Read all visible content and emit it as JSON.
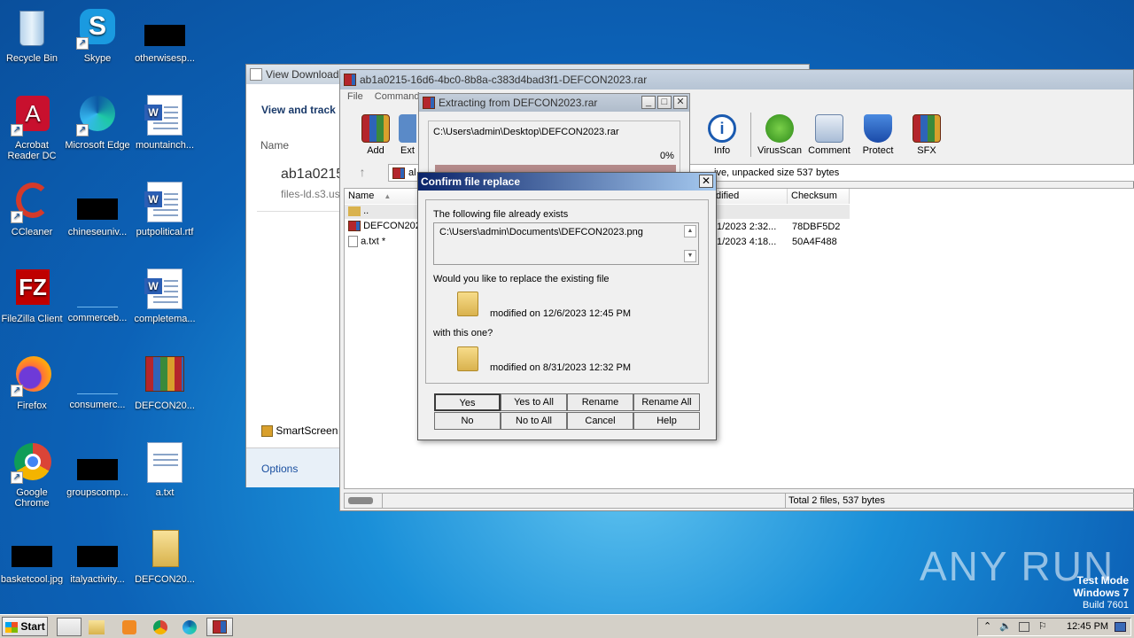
{
  "desktop": {
    "icons": [
      {
        "label": "Recycle Bin"
      },
      {
        "label": "Skype"
      },
      {
        "label": "otherwisesp..."
      },
      {
        "label": "Acrobat Reader DC"
      },
      {
        "label": "Microsoft Edge"
      },
      {
        "label": "mountainch..."
      },
      {
        "label": "CCleaner"
      },
      {
        "label": "chineseuniv..."
      },
      {
        "label": "putpolitical.rtf"
      },
      {
        "label": "FileZilla Client"
      },
      {
        "label": "commerceb..."
      },
      {
        "label": "completema..."
      },
      {
        "label": "Firefox"
      },
      {
        "label": "consumerc..."
      },
      {
        "label": "DEFCON20..."
      },
      {
        "label": "Google Chrome"
      },
      {
        "label": "groupscomp..."
      },
      {
        "label": "a.txt"
      },
      {
        "label": "basketcool.jpg"
      },
      {
        "label": "italyactivity..."
      },
      {
        "label": "DEFCON20..."
      }
    ]
  },
  "downloads_window": {
    "title": "View Downloads",
    "heading": "View and track",
    "col_name": "Name",
    "item_name": "ab1a0215",
    "item_source": "files-ld.s3.us",
    "smartscreen": "SmartScreen",
    "options": "Options"
  },
  "winrar": {
    "title": "ab1a0215-16d6-4bc0-8b8a-c383d4bad3f1-DEFCON2023.rar",
    "menu": {
      "file": "File",
      "commands": "Commands"
    },
    "toolbar": {
      "add": "Add",
      "extract": "Ext",
      "info": "Info",
      "virusscan": "VirusScan",
      "comment": "Comment",
      "protect": "Protect",
      "sfx": "SFX"
    },
    "path_info": "ive, unpacked size 537 bytes",
    "path_prefix": "al",
    "columns": {
      "name": "Name",
      "modified": "dified",
      "checksum": "Checksum"
    },
    "rows": [
      {
        "name": "..",
        "modified": "",
        "checksum": ""
      },
      {
        "name": "DEFCON202",
        "modified": "1/2023 2:32...",
        "checksum": "78DBF5D2"
      },
      {
        "name": "a.txt *",
        "modified": "1/2023 4:18...",
        "checksum": "50A4F488"
      }
    ],
    "status_total": "Total 2 files, 537 bytes"
  },
  "extract_window": {
    "title": "Extracting from DEFCON2023.rar",
    "path": "C:\\Users\\admin\\Desktop\\DEFCON2023.rar",
    "percent": "0%"
  },
  "confirm": {
    "title": "Confirm file replace",
    "exists_text": "The following file already exists",
    "file_path": "C:\\Users\\admin\\Documents\\DEFCON2023.png",
    "question": "Would you like to replace the existing file",
    "existing_modified": "modified on 12/6/2023 12:45 PM",
    "with_text": "with this one?",
    "new_modified": "modified on 8/31/2023 12:32 PM",
    "buttons": {
      "yes": "Yes",
      "yes_all": "Yes to All",
      "rename": "Rename",
      "rename_all": "Rename All",
      "no": "No",
      "no_all": "No to All",
      "cancel": "Cancel",
      "help": "Help"
    }
  },
  "watermark": {
    "brand": "ANY RUN",
    "mode": "Test Mode",
    "os": "Windows 7",
    "build": "Build 7601"
  },
  "taskbar": {
    "start": "Start",
    "time": "12:45 PM"
  }
}
